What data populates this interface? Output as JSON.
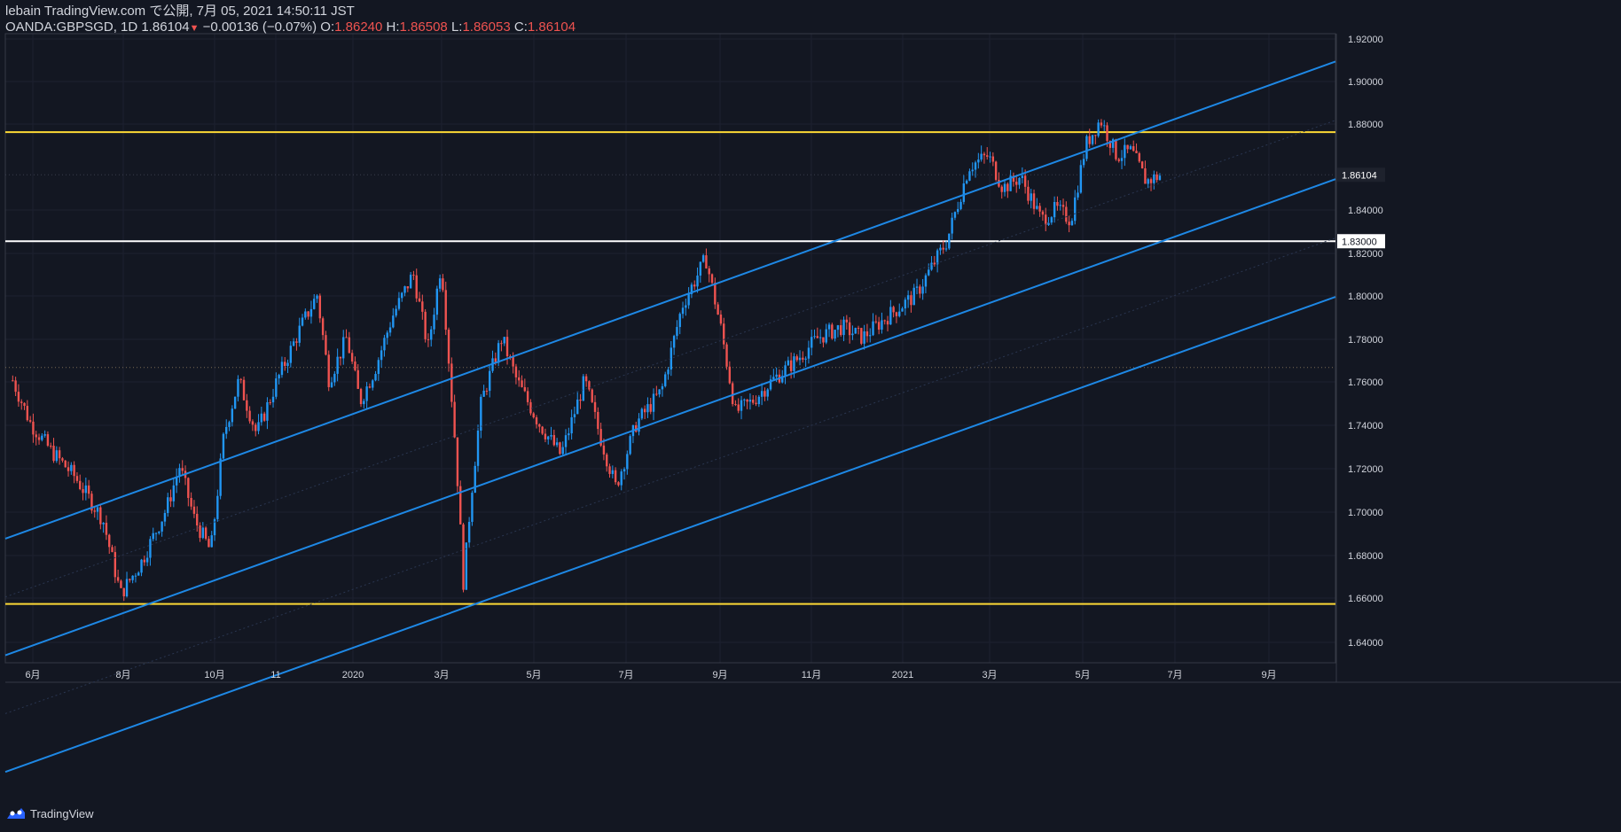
{
  "header": {
    "publish_line": "lebain TradingView.com で公開, 7月 05, 2021 14:50:11 JST",
    "symbol": "OANDA:GBPSGD, 1D",
    "last": "1.86104",
    "change": "−0.00136 (−0.07%)",
    "o_label": "O:",
    "o_value": "1.86240",
    "h_label": "H:",
    "h_value": "1.86508",
    "l_label": "L:",
    "l_value": "1.86053",
    "c_label": "C:",
    "c_value": "1.86104"
  },
  "footer": {
    "brand": "TradingView",
    "logo_icon": "tradingview-logo-icon"
  },
  "colors": {
    "background": "#131722",
    "up": "#2196f3",
    "down": "#ef5350",
    "channel": "#1e88e5",
    "support_resistance": "#fdd835",
    "level_white": "#ffffff",
    "axis_text": "#d1d4dc"
  },
  "chart_data": {
    "type": "candlestick",
    "title": "",
    "x_tick_labels": [
      "6月",
      "8月",
      "10月",
      "11",
      "2020",
      "3月",
      "5月",
      "7月",
      "9月",
      "11月",
      "2021",
      "3月",
      "5月",
      "7月",
      "9月"
    ],
    "y_tick_labels": [
      "1.92000",
      "1.90000",
      "1.88000",
      "1.84000",
      "1.82000",
      "1.80000",
      "1.78000",
      "1.76000",
      "1.74000",
      "1.72000",
      "1.70000",
      "1.68000",
      "1.66000",
      "1.64000"
    ],
    "ylim": [
      1.633,
      1.927
    ],
    "price_line": {
      "value": 1.86104,
      "label": "1.86104"
    },
    "white_level": {
      "value": 1.83,
      "label": "1.83000"
    },
    "yellow_levels": [
      1.881,
      1.6605
    ],
    "dotted_level": 1.771,
    "close_path": [
      [
        "2019-05-20",
        1.765
      ],
      [
        "2019-06-01",
        1.745
      ],
      [
        "2019-06-15",
        1.732
      ],
      [
        "2019-07-01",
        1.72
      ],
      [
        "2019-07-20",
        1.7
      ],
      [
        "2019-08-01",
        1.665
      ],
      [
        "2019-08-15",
        1.68
      ],
      [
        "2019-09-01",
        1.705
      ],
      [
        "2019-09-10",
        1.725
      ],
      [
        "2019-09-20",
        1.7
      ],
      [
        "2019-10-01",
        1.685
      ],
      [
        "2019-10-10",
        1.74
      ],
      [
        "2019-10-20",
        1.765
      ],
      [
        "2019-11-01",
        1.74
      ],
      [
        "2019-11-15",
        1.765
      ],
      [
        "2019-12-01",
        1.79
      ],
      [
        "2019-12-12",
        1.805
      ],
      [
        "2019-12-20",
        1.765
      ],
      [
        "2020-01-01",
        1.785
      ],
      [
        "2020-01-10",
        1.755
      ],
      [
        "2020-01-20",
        1.77
      ],
      [
        "2020-02-01",
        1.795
      ],
      [
        "2020-02-15",
        1.815
      ],
      [
        "2020-02-25",
        1.78
      ],
      [
        "2020-03-05",
        1.82
      ],
      [
        "2020-03-10",
        1.775
      ],
      [
        "2020-03-15",
        1.73
      ],
      [
        "2020-03-20",
        1.67
      ],
      [
        "2020-03-25",
        1.71
      ],
      [
        "2020-04-01",
        1.755
      ],
      [
        "2020-04-15",
        1.785
      ],
      [
        "2020-04-25",
        1.765
      ],
      [
        "2020-05-10",
        1.745
      ],
      [
        "2020-05-25",
        1.73
      ],
      [
        "2020-06-10",
        1.765
      ],
      [
        "2020-06-20",
        1.74
      ],
      [
        "2020-07-01",
        1.715
      ],
      [
        "2020-07-15",
        1.745
      ],
      [
        "2020-08-01",
        1.76
      ],
      [
        "2020-08-15",
        1.8
      ],
      [
        "2020-08-31",
        1.822
      ],
      [
        "2020-09-10",
        1.79
      ],
      [
        "2020-09-20",
        1.75
      ],
      [
        "2020-10-01",
        1.755
      ],
      [
        "2020-10-15",
        1.765
      ],
      [
        "2020-11-01",
        1.775
      ],
      [
        "2020-11-15",
        1.785
      ],
      [
        "2020-12-01",
        1.79
      ],
      [
        "2020-12-15",
        1.785
      ],
      [
        "2021-01-01",
        1.795
      ],
      [
        "2021-01-20",
        1.805
      ],
      [
        "2021-02-10",
        1.83
      ],
      [
        "2021-02-25",
        1.865
      ],
      [
        "2021-03-10",
        1.87
      ],
      [
        "2021-03-20",
        1.855
      ],
      [
        "2021-04-01",
        1.86
      ],
      [
        "2021-04-15",
        1.84
      ],
      [
        "2021-04-25",
        1.845
      ],
      [
        "2021-05-05",
        1.84
      ],
      [
        "2021-05-15",
        1.875
      ],
      [
        "2021-05-25",
        1.887
      ],
      [
        "2021-06-05",
        1.87
      ],
      [
        "2021-06-15",
        1.872
      ],
      [
        "2021-06-25",
        1.858
      ],
      [
        "2021-07-05",
        1.861
      ]
    ],
    "channel_lines": [
      {
        "name": "",
        "from": [
          "2019-05-15",
          1.691
        ],
        "to": [
          "2021-10-31",
          1.914
        ],
        "style": "solid"
      },
      {
        "name": "",
        "from": [
          "2019-05-15",
          1.6365
        ],
        "to": [
          "2021-10-31",
          1.859
        ],
        "style": "solid"
      },
      {
        "name": "",
        "from": [
          "2019-05-15",
          1.582
        ],
        "to": [
          "2021-10-31",
          1.804
        ],
        "style": "solid"
      }
    ],
    "grid": true,
    "legend": "none"
  }
}
